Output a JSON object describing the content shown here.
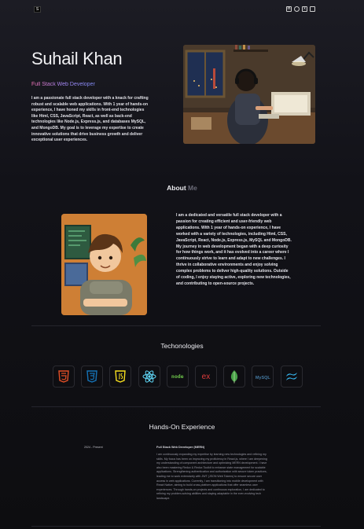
{
  "nav": {
    "logo": "S",
    "icons": [
      "linkedin-icon",
      "github-icon",
      "twitter-icon",
      "instagram-icon"
    ]
  },
  "hero": {
    "name": "Suhail Khan",
    "role": "Full Stack Web Developer",
    "bio": "I am a passionate full stack developer with a knack for crafting robust and scalable web applications. With 1 year of hands-on experience, I have honed my skills in front-end technologies like Html, CSS, JavaScript, React, as well as back-end technologies like Node.js, Express.js, and databases MySQL, and MongoDB. My goal is to leverage my expertise to create innovative solutions that drive business growth and deliver exceptional user experiences."
  },
  "about": {
    "title_main": "About",
    "title_muted": "Me",
    "text": "I am a dedicated and versatile full stack developer with a passion for creating efficient and user-friendly web applications. With 1 year of hands-on experience, I have worked with a variety of technologies, including Html, CSS, JavaScript, React, Node.js, Express.js, MySQL and MongoDB. My journey in web development began with a deep curiosity for how things work, and it has evolved into a career where I continuously strive to learn and adapt to new challenges. I thrive in collaborative environments and enjoy solving complex problems to deliver high-quality solutions. Outside of coding, I enjoy staying active, exploring new technologies, and contributing to open-source projects."
  },
  "technologies": {
    "title": "Techonologies",
    "items": [
      {
        "name": "html5-icon",
        "color": "#e34f26"
      },
      {
        "name": "css3-icon",
        "color": "#1572b6"
      },
      {
        "name": "javascript-icon",
        "color": "#f7df1e"
      },
      {
        "name": "react-icon",
        "color": "#61dafb"
      },
      {
        "name": "nodejs-icon",
        "color": "#6cc24a"
      },
      {
        "name": "express-icon",
        "color": "#e23c3c"
      },
      {
        "name": "mongodb-icon",
        "color": "#47a248"
      },
      {
        "name": "mysql-icon",
        "color": "#4479a1"
      },
      {
        "name": "tailwind-icon",
        "color": "#38bdf8"
      }
    ],
    "text_labels": {
      "node": "node",
      "express": "ex",
      "mysql": "MySQL"
    }
  },
  "experience": {
    "title": "Hands-On Experience",
    "items": [
      {
        "date": "2024 - Present",
        "role": "Full Stack Web Developer (MERN)",
        "description": "I am continuously expanding my expertise by learning new technologies and refining my skills. My focus has been on improving my proficiency in React.js, where I am deepening my understanding of component architecture and optimizing MERN development. I have also been mastering Redux & Redux Toolkit to enhance state management for scalable applications. Strengthening authentication and authorization with secure token practices, leading me to work extensively with JWT (JSON Web Tokens) to ensure secure user access in web applications. Currently, I am transitioning into mobile development with React Native, aiming to build cross-platform applications that offer seamless user experiences. Through hands-on projects and continuous exploration, I am dedicated to refining my problem-solving abilities and staying adaptable in the ever-evolving tech landscape."
      }
    ]
  }
}
